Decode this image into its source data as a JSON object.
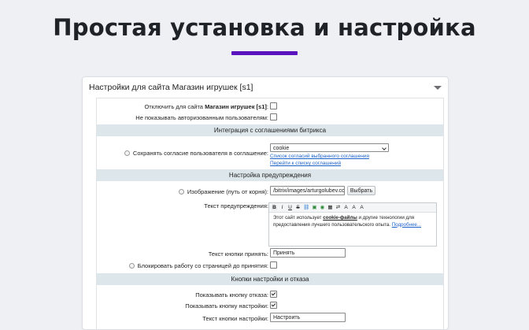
{
  "hero": {
    "title": "Простая установка и настройка",
    "underline_color": "#5b13c0"
  },
  "card": {
    "title": "Настройки для сайта Магазин игрушек [s1]",
    "disable": {
      "label_prefix": "Отключить для сайта",
      "label_bold": "Магазин игрушек [s1]",
      "label_suffix": ":",
      "checked": false
    },
    "hide_for_auth": {
      "label": "Не показывать авторизованным пользователям:",
      "checked": false
    },
    "section1": "Интеграция с соглашениями битрикса",
    "agreement": {
      "label": "Сохранять согласие пользователя в соглашение:",
      "selected": "cookie",
      "link1": "Список согласий выбранного соглашения",
      "link2": "Перейти к списку соглашений"
    },
    "section2": "Настройка предупреждения",
    "image": {
      "label": "Изображение (путь от корня):",
      "value": "/bitrix/images/arturgolubev.cookies",
      "button": "Выбрать"
    },
    "warning": {
      "label": "Текст предупреждения:",
      "toolbar": [
        "B",
        "I",
        "U",
        "S",
        "A",
        "A",
        "A"
      ],
      "text_before": "Этот сайт использует ",
      "text_link": "cookie-файлы",
      "text_after": " и другие технологии для предоставления лучшего пользовательского опыта. ",
      "text_more": "Подробнее..."
    },
    "accept_text": {
      "label": "Текст кнопки принять:",
      "value": "Принять"
    },
    "block_page": {
      "label": "Блокировать работу со страницей до принятия:",
      "checked": false
    },
    "section3": "Кнопки настройки и отказа",
    "show_reject": {
      "label": "Показывать кнопку отказа:",
      "checked": true
    },
    "show_settings": {
      "label": "Показывать кнопку настройки:",
      "checked": true
    },
    "settings_text": {
      "label": "Текст кнопки настройки:",
      "value": "Настроить"
    }
  }
}
